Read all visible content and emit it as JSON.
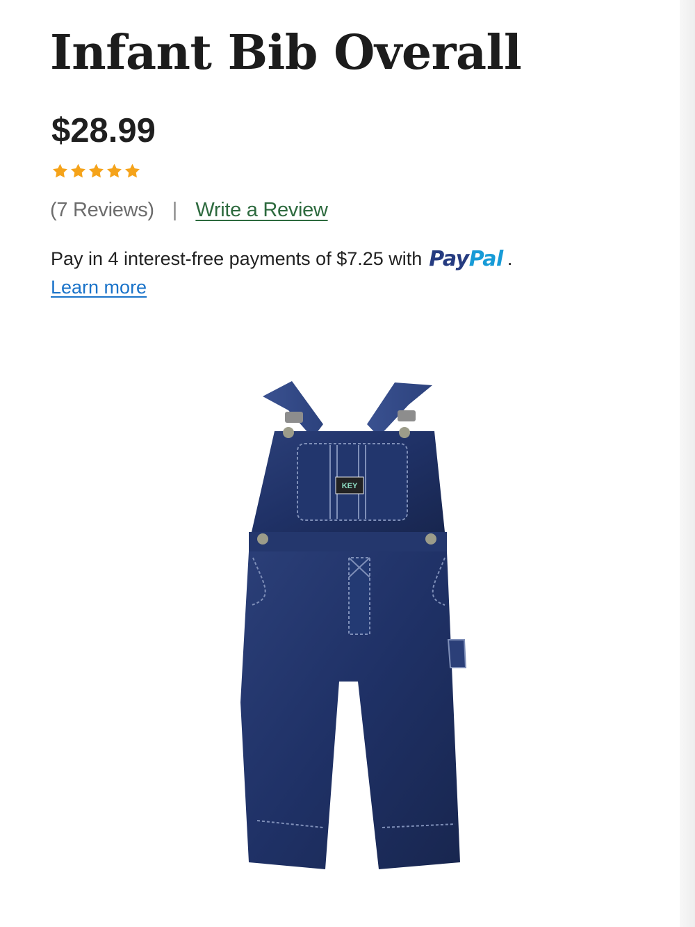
{
  "product": {
    "title": "Infant Bib Overall",
    "price": "$28.99",
    "rating": {
      "value": 5,
      "max": 5,
      "color": "#f5a31a"
    },
    "reviews_label": "(7 Reviews)",
    "separator": "|",
    "write_review_label": "Write a Review",
    "image_label": "KEY"
  },
  "paypal": {
    "message": "Pay in 4 interest-free payments of $7.25 with",
    "logo_pay": "Pay",
    "logo_pal": "Pal",
    "period": ".",
    "learn_more": "Learn more"
  }
}
